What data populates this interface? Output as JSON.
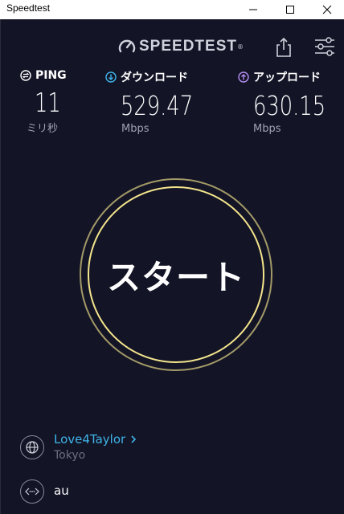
{
  "window": {
    "title": "Speedtest"
  },
  "header": {
    "logo_text": "SPEEDTEST",
    "logo_mark": "®"
  },
  "metrics": {
    "ping": {
      "label": "PING",
      "value": "11",
      "unit": "ミリ秒",
      "icon": "ping-icon"
    },
    "download": {
      "label": "ダウンロード",
      "value": "529.47",
      "unit": "Mbps",
      "icon": "download-arrow-icon"
    },
    "upload": {
      "label": "アップロード",
      "value": "630.15",
      "unit": "Mbps",
      "icon": "upload-arrow-icon"
    }
  },
  "start": {
    "label": "スタート"
  },
  "provider": {
    "name": "Love4Taylor",
    "location": "Tokyo"
  },
  "isp": {
    "name": "au"
  },
  "colors": {
    "background": "#131426",
    "download_accent": "#3fb4e8",
    "upload_accent": "#b58df0",
    "ring_inner": "#f4e58c",
    "ring_outer": "#a39a67",
    "link": "#3fb4e8"
  }
}
